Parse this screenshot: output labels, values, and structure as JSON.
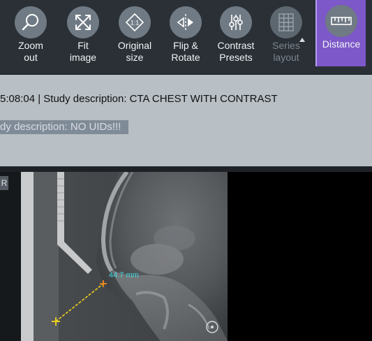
{
  "toolbar": {
    "tools": [
      {
        "label": "Zoom\nout",
        "icon": "zoom-out-icon",
        "state": "normal"
      },
      {
        "label": "Fit\nimage",
        "icon": "fit-image-icon",
        "state": "normal"
      },
      {
        "label": "Original\nsize",
        "icon": "original-size-icon",
        "state": "normal"
      },
      {
        "label": "Flip &\nRotate",
        "icon": "flip-rotate-icon",
        "state": "normal"
      },
      {
        "label": "Contrast\nPresets",
        "icon": "contrast-presets-icon",
        "state": "normal"
      },
      {
        "label": "Series\nlayout",
        "icon": "series-layout-icon",
        "state": "disabled"
      },
      {
        "label": "Distance",
        "icon": "ruler-icon",
        "state": "active"
      }
    ],
    "original_size_icon_text": "1:1"
  },
  "info": {
    "line1": "5:08:04 | Study description: CTA CHEST WITH CONTRAST",
    "line2": "dy description: NO UIDs!!!"
  },
  "viewer": {
    "corner_button": "R",
    "measurement": "44.7 mm"
  },
  "colors": {
    "toolbar_bg": "#2a3036",
    "active_tool": "#7d58c8",
    "info_bg": "#b8bfc5",
    "measurement_line": "#f2d21b",
    "measurement_text": "#40d9e0"
  }
}
